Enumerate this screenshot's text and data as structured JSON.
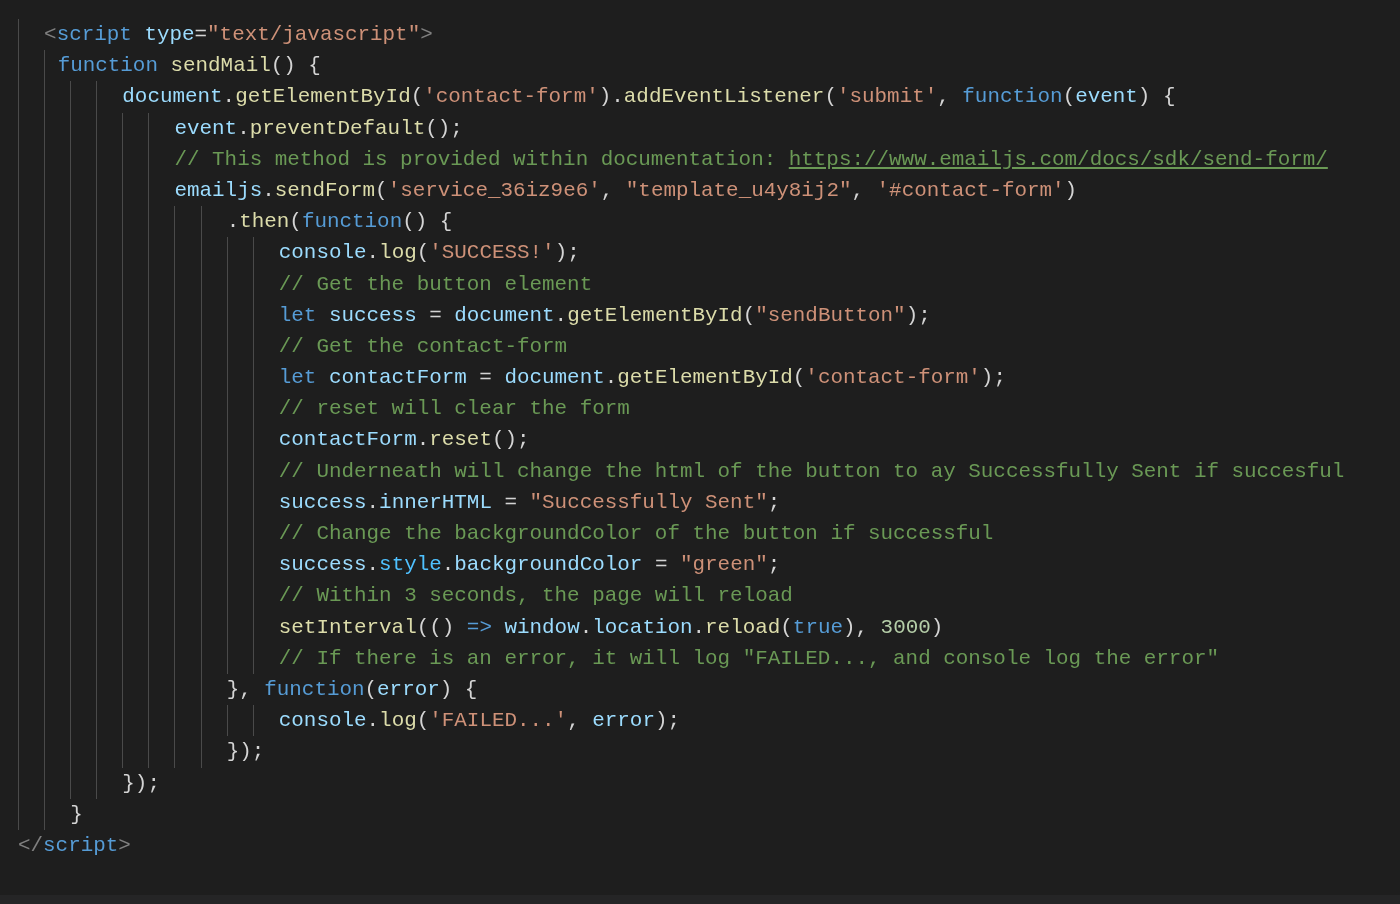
{
  "editor": {
    "lines": [
      {
        "tokens": [
          {
            "kind": "tag",
            "text": "  <"
          },
          {
            "kind": "name",
            "text": "script"
          },
          {
            "kind": "attr",
            "text": " type"
          },
          {
            "kind": "p",
            "text": "="
          },
          {
            "kind": "str",
            "text": "\"text/javascript\""
          },
          {
            "kind": "tag",
            "text": ">"
          }
        ]
      },
      {
        "tokens": [
          {
            "kind": "kw",
            "text": "   function"
          },
          {
            "kind": "fn",
            "text": " sendMail"
          },
          {
            "kind": "p",
            "text": "() {"
          }
        ]
      },
      {
        "tokens": [
          {
            "kind": "var",
            "text": "        document"
          },
          {
            "kind": "p",
            "text": "."
          },
          {
            "kind": "fn",
            "text": "getElementById"
          },
          {
            "kind": "p",
            "text": "("
          },
          {
            "kind": "str",
            "text": "'contact-form'"
          },
          {
            "kind": "p",
            "text": ")."
          },
          {
            "kind": "fn",
            "text": "addEventListener"
          },
          {
            "kind": "p",
            "text": "("
          },
          {
            "kind": "str",
            "text": "'submit'"
          },
          {
            "kind": "p",
            "text": ", "
          },
          {
            "kind": "kw",
            "text": "function"
          },
          {
            "kind": "p",
            "text": "("
          },
          {
            "kind": "var",
            "text": "event"
          },
          {
            "kind": "p",
            "text": ") {"
          }
        ]
      },
      {
        "tokens": [
          {
            "kind": "var",
            "text": "            event"
          },
          {
            "kind": "p",
            "text": "."
          },
          {
            "kind": "fn",
            "text": "preventDefault"
          },
          {
            "kind": "p",
            "text": "();"
          }
        ]
      },
      {
        "tokens": [
          {
            "kind": "cm",
            "text": "            // This method is provided within documentation: "
          },
          {
            "kind": "link",
            "text": "https://www.emailjs.com/docs/sdk/send-form/"
          }
        ]
      },
      {
        "tokens": [
          {
            "kind": "var",
            "text": "            emailjs"
          },
          {
            "kind": "p",
            "text": "."
          },
          {
            "kind": "fn",
            "text": "sendForm"
          },
          {
            "kind": "p",
            "text": "("
          },
          {
            "kind": "str",
            "text": "'service_36iz9e6'"
          },
          {
            "kind": "p",
            "text": ", "
          },
          {
            "kind": "str",
            "text": "\"template_u4y8ij2\""
          },
          {
            "kind": "p",
            "text": ", "
          },
          {
            "kind": "str",
            "text": "'#contact-form'"
          },
          {
            "kind": "p",
            "text": ")"
          }
        ]
      },
      {
        "tokens": [
          {
            "kind": "p",
            "text": "                ."
          },
          {
            "kind": "fn",
            "text": "then"
          },
          {
            "kind": "p",
            "text": "("
          },
          {
            "kind": "kw",
            "text": "function"
          },
          {
            "kind": "p",
            "text": "() {"
          }
        ]
      },
      {
        "tokens": [
          {
            "kind": "var",
            "text": "                    console"
          },
          {
            "kind": "p",
            "text": "."
          },
          {
            "kind": "fn",
            "text": "log"
          },
          {
            "kind": "p",
            "text": "("
          },
          {
            "kind": "str",
            "text": "'SUCCESS!'"
          },
          {
            "kind": "p",
            "text": ");"
          }
        ]
      },
      {
        "tokens": [
          {
            "kind": "cm",
            "text": "                    // Get the button element"
          }
        ]
      },
      {
        "tokens": [
          {
            "kind": "kw",
            "text": "                    let"
          },
          {
            "kind": "var",
            "text": " success"
          },
          {
            "kind": "p",
            "text": " = "
          },
          {
            "kind": "var",
            "text": "document"
          },
          {
            "kind": "p",
            "text": "."
          },
          {
            "kind": "fn",
            "text": "getElementById"
          },
          {
            "kind": "p",
            "text": "("
          },
          {
            "kind": "str",
            "text": "\"sendButton\""
          },
          {
            "kind": "p",
            "text": ");"
          }
        ]
      },
      {
        "tokens": [
          {
            "kind": "cm",
            "text": "                    // Get the contact-form"
          }
        ]
      },
      {
        "tokens": [
          {
            "kind": "kw",
            "text": "                    let"
          },
          {
            "kind": "var",
            "text": " contactForm"
          },
          {
            "kind": "p",
            "text": " = "
          },
          {
            "kind": "var",
            "text": "document"
          },
          {
            "kind": "p",
            "text": "."
          },
          {
            "kind": "fn",
            "text": "getElementById"
          },
          {
            "kind": "p",
            "text": "("
          },
          {
            "kind": "str",
            "text": "'contact-form'"
          },
          {
            "kind": "p",
            "text": ");"
          }
        ]
      },
      {
        "tokens": [
          {
            "kind": "cm",
            "text": "                    // reset will clear the form"
          }
        ]
      },
      {
        "tokens": [
          {
            "kind": "var",
            "text": "                    contactForm"
          },
          {
            "kind": "p",
            "text": "."
          },
          {
            "kind": "fn",
            "text": "reset"
          },
          {
            "kind": "p",
            "text": "();"
          }
        ]
      },
      {
        "tokens": [
          {
            "kind": "cm",
            "text": "                    // Underneath will change the html of the button to ay Successfully Sent if succesful"
          }
        ]
      },
      {
        "tokens": [
          {
            "kind": "var",
            "text": "                    success"
          },
          {
            "kind": "p",
            "text": "."
          },
          {
            "kind": "var",
            "text": "innerHTML"
          },
          {
            "kind": "p",
            "text": " = "
          },
          {
            "kind": "str",
            "text": "\"Successfully Sent\""
          },
          {
            "kind": "p",
            "text": ";"
          }
        ]
      },
      {
        "tokens": [
          {
            "kind": "cm",
            "text": "                    // Change the backgroundColor of the button if successful"
          }
        ]
      },
      {
        "tokens": [
          {
            "kind": "var",
            "text": "                    success"
          },
          {
            "kind": "p",
            "text": "."
          },
          {
            "kind": "cst",
            "text": "style"
          },
          {
            "kind": "p",
            "text": "."
          },
          {
            "kind": "var",
            "text": "backgroundColor"
          },
          {
            "kind": "p",
            "text": " = "
          },
          {
            "kind": "str",
            "text": "\"green\""
          },
          {
            "kind": "p",
            "text": ";"
          }
        ]
      },
      {
        "tokens": [
          {
            "kind": "cm",
            "text": "                    // Within 3 seconds, the page will reload"
          }
        ]
      },
      {
        "tokens": [
          {
            "kind": "fn",
            "text": "                    setInterval"
          },
          {
            "kind": "p",
            "text": "(() "
          },
          {
            "kind": "kw",
            "text": "=>"
          },
          {
            "kind": "var",
            "text": " window"
          },
          {
            "kind": "p",
            "text": "."
          },
          {
            "kind": "var",
            "text": "location"
          },
          {
            "kind": "p",
            "text": "."
          },
          {
            "kind": "fn",
            "text": "reload"
          },
          {
            "kind": "p",
            "text": "("
          },
          {
            "kind": "kw",
            "text": "true"
          },
          {
            "kind": "p",
            "text": "), "
          },
          {
            "kind": "num",
            "text": "3000"
          },
          {
            "kind": "p",
            "text": ")"
          }
        ]
      },
      {
        "tokens": [
          {
            "kind": "cm",
            "text": "                    // If there is an error, it will log \"FAILED..., and console log the error\""
          }
        ]
      },
      {
        "tokens": [
          {
            "kind": "p",
            "text": "                }, "
          },
          {
            "kind": "kw",
            "text": "function"
          },
          {
            "kind": "p",
            "text": "("
          },
          {
            "kind": "var",
            "text": "error"
          },
          {
            "kind": "p",
            "text": ") {"
          }
        ]
      },
      {
        "tokens": [
          {
            "kind": "var",
            "text": "                    console"
          },
          {
            "kind": "p",
            "text": "."
          },
          {
            "kind": "fn",
            "text": "log"
          },
          {
            "kind": "p",
            "text": "("
          },
          {
            "kind": "str",
            "text": "'FAILED...'"
          },
          {
            "kind": "p",
            "text": ", "
          },
          {
            "kind": "var",
            "text": "error"
          },
          {
            "kind": "p",
            "text": ");"
          }
        ]
      },
      {
        "tokens": [
          {
            "kind": "p",
            "text": "                });"
          }
        ]
      },
      {
        "tokens": [
          {
            "kind": "p",
            "text": "        });"
          }
        ]
      },
      {
        "tokens": [
          {
            "kind": "p",
            "text": "    }"
          }
        ]
      },
      {
        "tokens": [
          {
            "kind": "tag",
            "text": "</"
          },
          {
            "kind": "name",
            "text": "script"
          },
          {
            "kind": "tag",
            "text": ">"
          }
        ]
      }
    ]
  }
}
